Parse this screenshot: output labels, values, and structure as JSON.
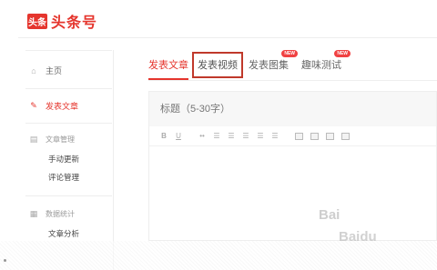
{
  "brand": {
    "logo_box": "头条",
    "name": "头条号",
    "color": "#e5352d"
  },
  "sidebar": {
    "home": "主页",
    "publish": "发表文章",
    "article_mgmt": {
      "label": "文章管理",
      "items": [
        "手动更新",
        "评论管理"
      ]
    },
    "stats": {
      "label": "数据统计",
      "items": [
        "文章分析"
      ]
    }
  },
  "tabs": [
    {
      "label": "发表文章",
      "active": true
    },
    {
      "label": "发表视频",
      "highlighted": true
    },
    {
      "label": "发表图集",
      "badge": "NEW"
    },
    {
      "label": "趣味测试",
      "badge": "NEW"
    }
  ],
  "editor": {
    "title_placeholder": "标题（5-30字）",
    "toolbar": [
      "B",
      "U",
      "••",
      "☰",
      "☰",
      "☰",
      "☰",
      "☰",
      "▣",
      "▣",
      "▣",
      "▣"
    ]
  },
  "watermark": [
    "Bai",
    "Baidu"
  ]
}
